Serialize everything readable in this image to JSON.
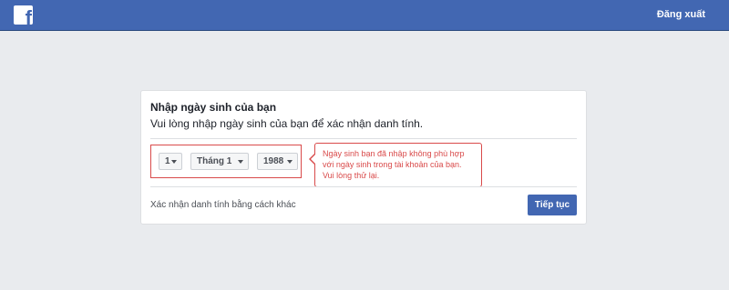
{
  "header": {
    "logo_icon": "facebook-f-icon",
    "logo_glyph": "f",
    "logout_label": "Đăng xuất",
    "brand_color": "#4267b2"
  },
  "card": {
    "title": "Nhập ngày sinh của bạn",
    "subtitle": "Vui lòng nhập ngày sinh của bạn để xác nhận danh tính.",
    "dob": {
      "day": "1",
      "month": "Tháng 1",
      "year": "1988"
    },
    "error": {
      "lines": [
        "Ngày sinh bạn đã nhập không phù hợp",
        "với ngày sinh trong tài khoản của bạn.",
        "Vui lòng thử lại."
      ],
      "color": "#d94a4a"
    },
    "alt_link_label": "Xác nhận danh tính bằng cách khác",
    "continue_label": "Tiếp tục"
  }
}
